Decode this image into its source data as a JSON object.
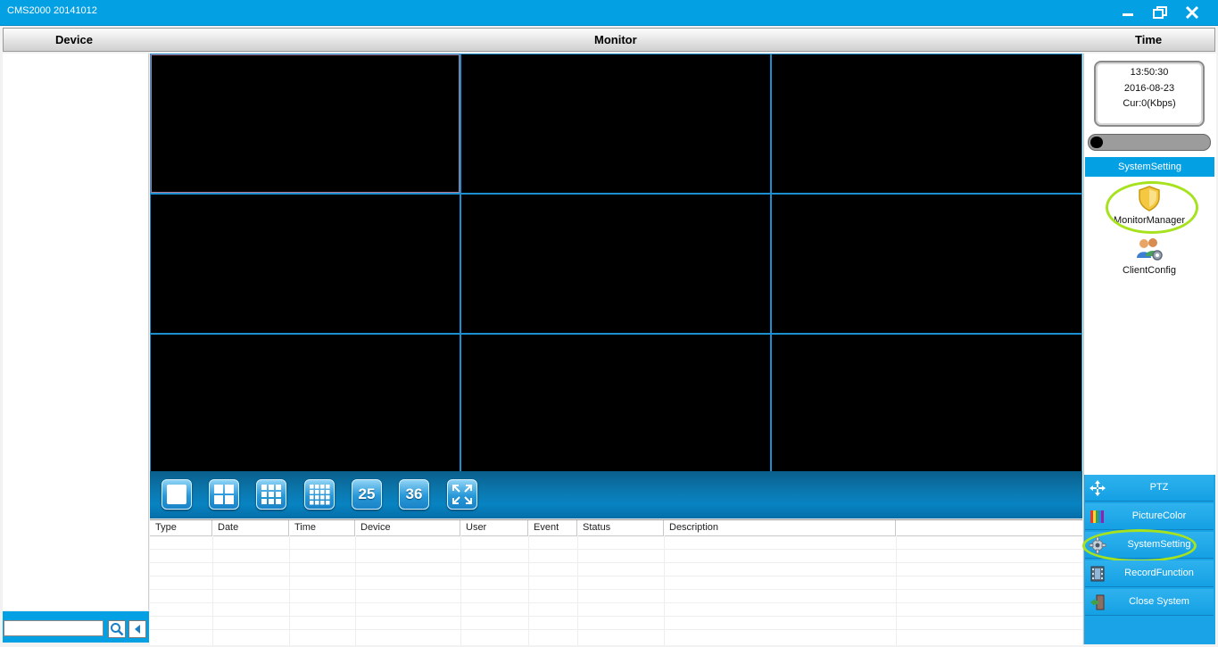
{
  "app": {
    "title": "CMS2000 20141012"
  },
  "window_controls": {
    "minimize_icon": "minimize-icon",
    "restore_icon": "restore-icon",
    "close_icon": "close-icon"
  },
  "header": {
    "device": "Device",
    "monitor": "Monitor",
    "time": "Time"
  },
  "device_panel": {
    "search_value": "",
    "search_icon": "search-icon",
    "back_icon": "left-arrow-icon"
  },
  "monitor": {
    "rows": 3,
    "cols": 3,
    "selected_cell": 1
  },
  "layout_buttons": [
    {
      "name": "layout-1-button",
      "label": ""
    },
    {
      "name": "layout-4-button",
      "label": ""
    },
    {
      "name": "layout-9-button",
      "label": ""
    },
    {
      "name": "layout-16-button",
      "label": ""
    },
    {
      "name": "layout-25-button",
      "label": "25"
    },
    {
      "name": "layout-36-button",
      "label": "36"
    },
    {
      "name": "fullscreen-button",
      "label": ""
    }
  ],
  "event_table": {
    "columns": [
      "Type",
      "Date",
      "Time",
      "Device",
      "User",
      "Event",
      "Status",
      "Description",
      ""
    ],
    "rows": []
  },
  "time_panel": {
    "time": "13:50:30",
    "date": "2016-08-23",
    "rate": "Cur:0(Kbps)",
    "bandwidth_fraction": 0.05
  },
  "system_setting": {
    "header": "SystemSetting",
    "tools": [
      {
        "label": "MonitorManager",
        "icon": "shield-icon",
        "highlighted": true
      },
      {
        "label": "ClientConfig",
        "icon": "users-gear-icon",
        "highlighted": false
      }
    ]
  },
  "nav": [
    {
      "label": "PTZ",
      "icon": "move-arrows-icon"
    },
    {
      "label": "PictureColor",
      "icon": "color-bars-icon"
    },
    {
      "label": "SystemSetting",
      "icon": "gear-icon",
      "highlighted": true
    },
    {
      "label": "RecordFunction",
      "icon": "film-icon"
    },
    {
      "label": "Close System",
      "icon": "exit-door-icon"
    }
  ],
  "colors": {
    "accent": "#04a0e4",
    "highlight": "#a6e21e",
    "grid_line": "#1b8fd0"
  }
}
